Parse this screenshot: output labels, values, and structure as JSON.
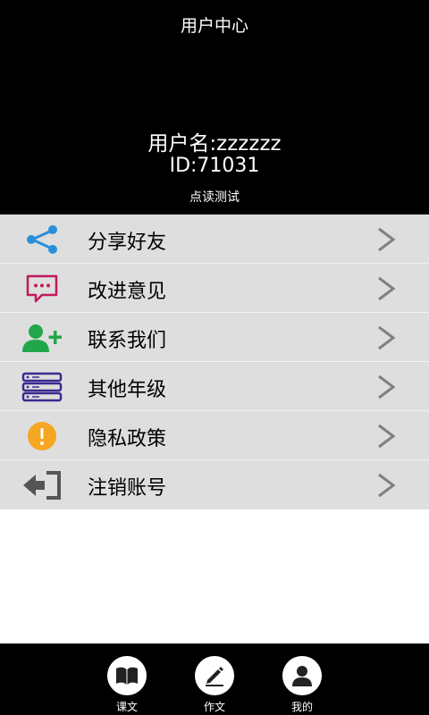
{
  "header": {
    "title": "用户中心",
    "username": "用户名:zzzzzz",
    "user_id": "ID:71031",
    "subtitle": "点读测试"
  },
  "menu": {
    "items": [
      {
        "label": "分享好友",
        "icon": "share-icon",
        "color": "#2b8fd8"
      },
      {
        "label": "改进意见",
        "icon": "message-icon",
        "color": "#c2185b"
      },
      {
        "label": "联系我们",
        "icon": "add-user-icon",
        "color": "#22a64a"
      },
      {
        "label": "其他年级",
        "icon": "server-icon",
        "color": "#3b2a8f"
      },
      {
        "label": "隐私政策",
        "icon": "alert-icon",
        "color": "#f5a623"
      },
      {
        "label": "注销账号",
        "icon": "logout-icon",
        "color": "#555555"
      }
    ]
  },
  "tabbar": {
    "tabs": [
      {
        "label": "课文",
        "icon": "book-icon"
      },
      {
        "label": "作文",
        "icon": "pencil-icon"
      },
      {
        "label": "我的",
        "icon": "user-icon"
      }
    ]
  }
}
